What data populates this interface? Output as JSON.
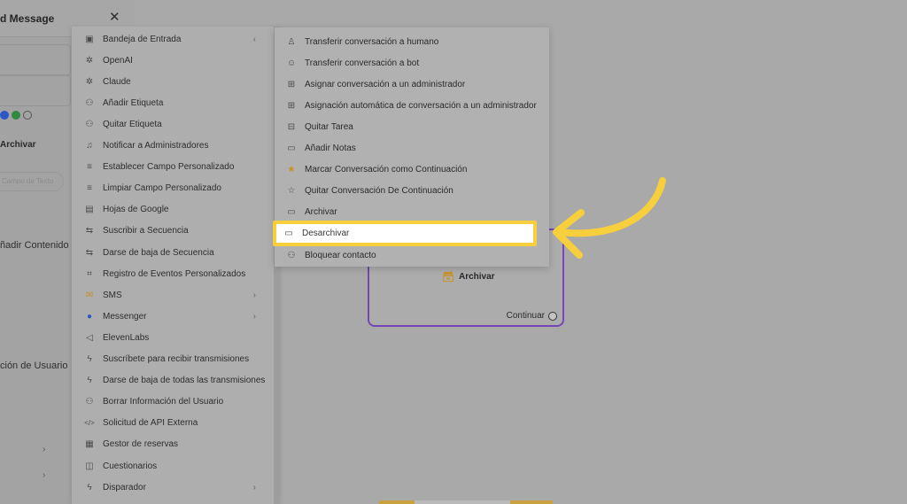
{
  "left_panel": {
    "title": "d Message",
    "archive_label": "Archivar",
    "placeholder_pill": "Campo de Texto",
    "add_content": "ñadir Contenido",
    "user_action": "ción de Usuario"
  },
  "menu1": {
    "items": [
      {
        "label": "Bandeja de Entrada",
        "icon": "inbox-icon",
        "chevron": "‹"
      },
      {
        "label": "OpenAI",
        "icon": "openai-icon"
      },
      {
        "label": "Claude",
        "icon": "claude-icon"
      },
      {
        "label": "Añadir Etiqueta",
        "icon": "user-tag-icon"
      },
      {
        "label": "Quitar Etiqueta",
        "icon": "user-tag-icon"
      },
      {
        "label": "Notificar a Administradores",
        "icon": "bell-icon"
      },
      {
        "label": "Establecer Campo Personalizado",
        "icon": "database-icon"
      },
      {
        "label": "Limpiar Campo Personalizado",
        "icon": "database-icon"
      },
      {
        "label": "Hojas de Google",
        "icon": "sheets-icon"
      },
      {
        "label": "Suscribir a Secuencia",
        "icon": "sequence-icon"
      },
      {
        "label": "Darse de baja de Secuencia",
        "icon": "sequence-icon"
      },
      {
        "label": "Registro de Eventos Personalizados",
        "icon": "event-icon"
      },
      {
        "label": "SMS",
        "icon": "sms-icon",
        "chevron": "›"
      },
      {
        "label": "Messenger",
        "icon": "messenger-icon",
        "chevron": "›"
      },
      {
        "label": "ElevenLabs",
        "icon": "audio-icon"
      },
      {
        "label": "Suscríbete para recibir transmisiones",
        "icon": "bolt-icon"
      },
      {
        "label": "Darse de baja de todas las transmisiones",
        "icon": "bolt-icon"
      },
      {
        "label": "Borrar Información del Usuario",
        "icon": "user-remove-icon"
      },
      {
        "label": "Solicitud de API Externa",
        "icon": "code-icon"
      },
      {
        "label": "Gestor de reservas",
        "icon": "calendar-icon"
      },
      {
        "label": "Cuestionarios",
        "icon": "quiz-icon"
      },
      {
        "label": "Disparador",
        "icon": "trigger-icon",
        "chevron": "›"
      }
    ]
  },
  "menu2": {
    "items": [
      {
        "label": "Transferir conversación a humano",
        "icon": "person-icon"
      },
      {
        "label": "Transferir conversación a bot",
        "icon": "bot-icon"
      },
      {
        "label": "Asignar conversación a un administrador",
        "icon": "chat-assign-icon"
      },
      {
        "label": "Asignación automática de conversación a un administrador",
        "icon": "chat-assign-icon"
      },
      {
        "label": "Quitar Tarea",
        "icon": "chat-remove-icon"
      },
      {
        "label": "Añadir Notas",
        "icon": "note-icon"
      },
      {
        "label": "Marcar Conversación como Continuación",
        "icon": "star-filled-icon"
      },
      {
        "label": "Quitar Conversación De Continuación",
        "icon": "star-outline-icon"
      },
      {
        "label": "Archivar",
        "icon": "archive-icon"
      },
      {
        "label": "Desarchivar",
        "icon": "unarchive-icon"
      },
      {
        "label": "Bloquear contacto",
        "icon": "block-users-icon"
      }
    ]
  },
  "node": {
    "label": "Archivar",
    "continue_label": "Continuar"
  },
  "colors": {
    "highlight": "#f7cf3c",
    "node_border": "#7547b6",
    "star": "#c9931f"
  }
}
